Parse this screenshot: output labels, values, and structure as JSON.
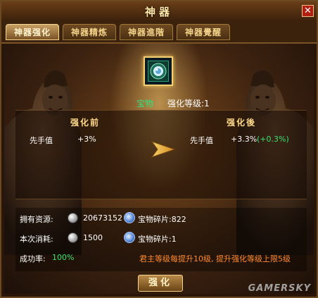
{
  "window": {
    "title": "神器"
  },
  "tabs": [
    {
      "label": "神器强化",
      "active": true
    },
    {
      "label": "神器精炼",
      "active": false
    },
    {
      "label": "神器進階",
      "active": false
    },
    {
      "label": "神器覺醒",
      "active": false
    }
  ],
  "item": {
    "name": "宝物",
    "level_text": "强化等级:1",
    "icon": "jade-orb-icon"
  },
  "compare": {
    "before_title": "强化前",
    "after_title": "强化後",
    "before": {
      "stat_label": "先手值",
      "stat_value": "+3%"
    },
    "after": {
      "stat_label": "先手值",
      "stat_value": "+3.3%",
      "bonus": "(+0.3%)"
    }
  },
  "resources": {
    "owned_label": "拥有资源:",
    "owned_silver": "20673152",
    "owned_shards": "宝物碎片:822",
    "cost_label": "本次消耗:",
    "cost_silver": "1500",
    "cost_shards": "宝物碎片:1",
    "success_label": "成功率:",
    "success_value": "100%",
    "hint": "君主等级每提升10级, 提升强化等级上限5级"
  },
  "button": {
    "label": "强化"
  },
  "watermark": "GAMERSKY",
  "colors": {
    "accent_gold": "#ffd98a",
    "bonus_green": "#39e26e",
    "hint_orange": "#ff8a2e",
    "close_red": "#b01f10"
  }
}
